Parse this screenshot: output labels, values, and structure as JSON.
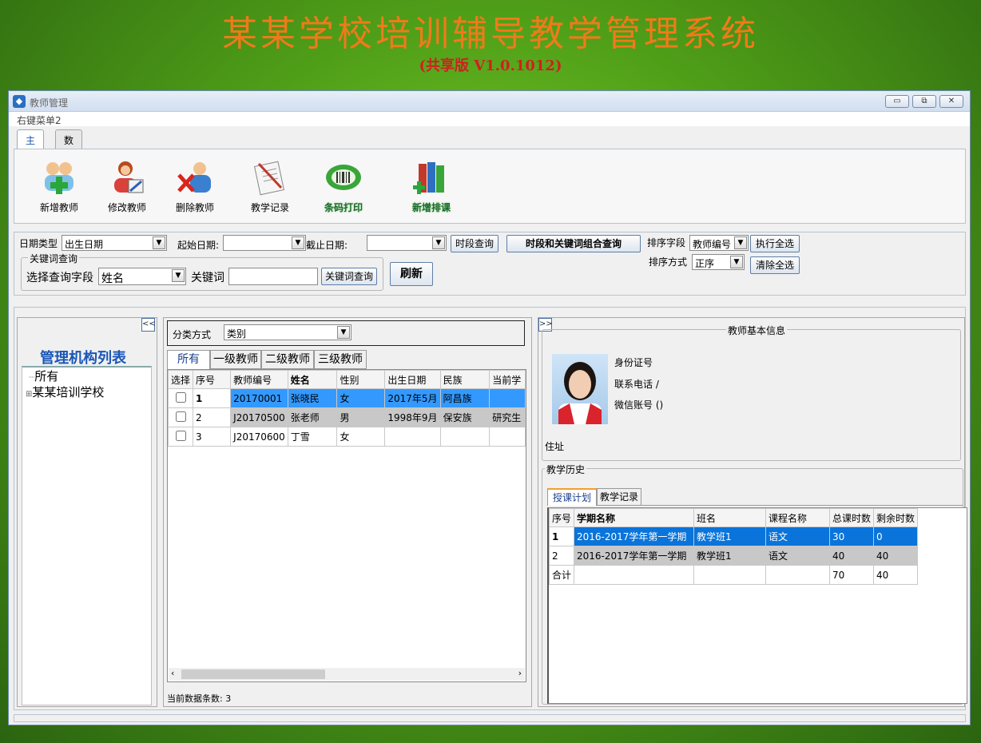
{
  "banner": {
    "title": "某某学校培训辅导教学管理系统",
    "version": "(共享版 V1.0.1012)"
  },
  "window": {
    "title": "教师管理",
    "menu_label": "右键菜单2",
    "controls": [
      "minimize-icon",
      "restore-icon",
      "close-icon"
    ]
  },
  "ribbon": {
    "tabs": [
      "主页",
      "数据"
    ],
    "buttons": [
      {
        "label": "新增教师",
        "icon": "add-teacher-icon"
      },
      {
        "label": "修改教师",
        "icon": "edit-teacher-icon"
      },
      {
        "label": "删除教师",
        "icon": "delete-teacher-icon"
      },
      {
        "label": "教学记录",
        "icon": "teaching-record-icon"
      },
      {
        "label": "条码打印",
        "icon": "barcode-print-icon"
      },
      {
        "label": "新增排课",
        "icon": "add-schedule-icon"
      }
    ]
  },
  "query": {
    "date_type_label": "日期类型",
    "date_type_value": "出生日期",
    "start_date_label": "起始日期:",
    "end_date_label": "截止日期:",
    "period_query_btn": "时段查询",
    "combined_query_btn": "时段和关键词组合查询",
    "sort_field_label": "排序字段",
    "sort_field_value": "教师编号",
    "select_all_btn": "执行全选",
    "sort_order_label": "排序方式",
    "sort_order_value": "正序",
    "clear_all_btn": "清除全选",
    "keyword_group_title": "关键词查询",
    "field_label": "选择查询字段",
    "field_value": "姓名",
    "keyword_label": "关键词",
    "keyword_query_btn": "关键词查询",
    "refresh_btn": "刷新"
  },
  "org": {
    "collapse_label": "<<",
    "title": "管理机构列表",
    "items": [
      "所有",
      "某某培训学校"
    ]
  },
  "teachers": {
    "classify_label": "分类方式",
    "classify_value": "类别",
    "tabs": [
      "所有",
      "一级教师",
      "二级教师",
      "三级教师"
    ],
    "columns": [
      "选择",
      "序号",
      "教师编号",
      "姓名",
      "性别",
      "出生日期",
      "民族",
      "当前学"
    ],
    "rows": [
      {
        "no": "1",
        "id": "20170001",
        "name": "张晓民",
        "gender": "女",
        "birth": "2017年5月",
        "ethnic": "阿昌族",
        "edu": ""
      },
      {
        "no": "2",
        "id": "J20170500",
        "name": "张老师",
        "gender": "男",
        "birth": "1998年9月",
        "ethnic": "保安族",
        "edu": "研究生"
      },
      {
        "no": "3",
        "id": "J20170600",
        "name": "丁雪",
        "gender": "女",
        "birth": "",
        "ethnic": "",
        "edu": ""
      }
    ],
    "count_label": "当前数据条数: 3"
  },
  "info": {
    "expand_label": ">>",
    "group_title": "教师基本信息",
    "id_label": "身份证号",
    "phone_label": "联系电话 /",
    "wechat_label": "微信账号 ()",
    "address_label": "住址"
  },
  "history": {
    "group_title": "教学历史",
    "tabs": [
      "授课计划",
      "教学记录"
    ],
    "columns": [
      "序号",
      "学期名称",
      "班名",
      "课程名称",
      "总课时数",
      "剩余时数"
    ],
    "rows": [
      [
        "1",
        "2016-2017学年第一学期",
        "教学班1",
        "语文",
        "30",
        "0"
      ],
      [
        "2",
        "2016-2017学年第一学期",
        "教学班1",
        "语文",
        "40",
        "40"
      ],
      [
        "合计",
        "",
        "",
        "",
        "70",
        "40"
      ]
    ]
  },
  "colors": {
    "banner_title": "#f07a1a",
    "banner_version": "#d02020",
    "selected_row": "#3399ff",
    "accent_blue": "#1a56b8"
  }
}
